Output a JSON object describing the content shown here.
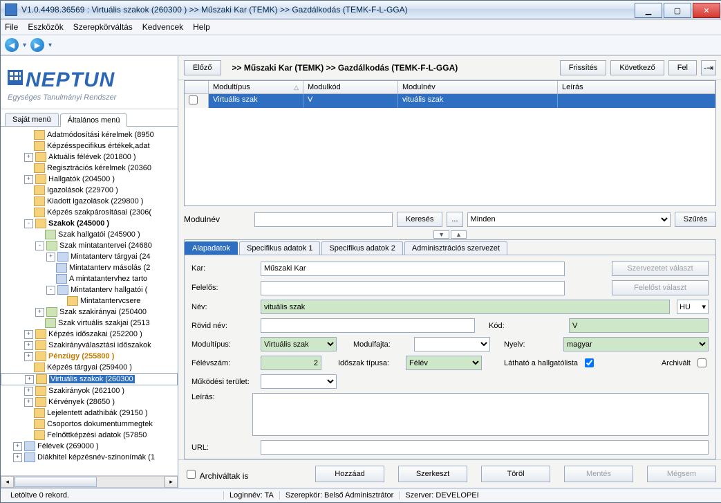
{
  "window": {
    "title": "V1.0.4498.36569 : Virtuális szakok (260300  )  >> Műszaki Kar (TEMK) >> Gazdálkodás (TEMK-F-L-GGA)"
  },
  "menu": {
    "file": "File",
    "eszkozok": "Eszközök",
    "szerep": "Szerepkörváltás",
    "kedvencek": "Kedvencek",
    "help": "Help"
  },
  "logo": {
    "text": "NEPTUN",
    "slogan": "Egységes Tanulmányi Rendszer"
  },
  "left_tabs": {
    "sajat": "Saját menü",
    "altalanos": "Általános menü"
  },
  "tree": [
    {
      "indent": 2,
      "exp": "",
      "lbl": "Adatmódosítási kérelmek (8950"
    },
    {
      "indent": 2,
      "exp": "",
      "lbl": "Képzésspecifikus értékek,adat"
    },
    {
      "indent": 2,
      "exp": "+",
      "lbl": "Aktuális félévek (201800  )"
    },
    {
      "indent": 2,
      "exp": "",
      "lbl": "Regisztrációs kérelmek (20360"
    },
    {
      "indent": 2,
      "exp": "+",
      "lbl": "Hallgatók (204500  )"
    },
    {
      "indent": 2,
      "exp": "",
      "lbl": "Igazolások (229700  )"
    },
    {
      "indent": 2,
      "exp": "",
      "lbl": "Kiadott igazolások (229800  )"
    },
    {
      "indent": 2,
      "exp": "",
      "lbl": "Képzés szakpárosításai (2306("
    },
    {
      "indent": 2,
      "exp": "-",
      "bold": true,
      "lbl": "Szakok (245000  )"
    },
    {
      "indent": 3,
      "exp": "",
      "icon": "alt",
      "lbl": "Szak hallgatói (245900  )"
    },
    {
      "indent": 3,
      "exp": "-",
      "icon": "alt",
      "lbl": "Szak mintatantervei (24680"
    },
    {
      "indent": 4,
      "exp": "+",
      "icon": "alt2",
      "lbl": "Mintatanterv tárgyai (24"
    },
    {
      "indent": 4,
      "exp": "",
      "icon": "alt2",
      "lbl": "Mintatanterv másolás (2"
    },
    {
      "indent": 4,
      "exp": "",
      "icon": "alt2",
      "lbl": "A mintatantervhez tarto"
    },
    {
      "indent": 4,
      "exp": "-",
      "icon": "alt2",
      "lbl": "Mintatanterv hallgatói ("
    },
    {
      "indent": 5,
      "exp": "",
      "lbl": "Mintatantervcsere"
    },
    {
      "indent": 3,
      "exp": "+",
      "icon": "alt",
      "lbl": "Szak szakirányai (250400"
    },
    {
      "indent": 3,
      "exp": "",
      "icon": "alt",
      "lbl": "Szak virtuális szakjai (2513"
    },
    {
      "indent": 2,
      "exp": "+",
      "lbl": "Képzés időszakai (252200  )"
    },
    {
      "indent": 2,
      "exp": "+",
      "lbl": "Szakirányválasztási időszakok"
    },
    {
      "indent": 2,
      "exp": "+",
      "hl": true,
      "lbl": "Pénzügy (255800  )"
    },
    {
      "indent": 2,
      "exp": "",
      "lbl": "Képzés tárgyai (259400  )"
    },
    {
      "indent": 2,
      "exp": "+",
      "sel": true,
      "lbl": "Virtuális szakok (260300"
    },
    {
      "indent": 2,
      "exp": "+",
      "lbl": "Szakirányok (262100  )"
    },
    {
      "indent": 2,
      "exp": "+",
      "lbl": "Kérvények (28650  )"
    },
    {
      "indent": 2,
      "exp": "",
      "lbl": "Lejelentett adathibák (29150  )"
    },
    {
      "indent": 2,
      "exp": "",
      "lbl": "Csoportos dokumentummegtek"
    },
    {
      "indent": 2,
      "exp": "",
      "lbl": "Felnőttképzési adatok (57850"
    },
    {
      "indent": 1,
      "exp": "+",
      "icon": "alt2",
      "lbl": "Félévek (269000  )"
    },
    {
      "indent": 1,
      "exp": "+",
      "icon": "alt2",
      "lbl": "Diákhitel képzésnév-szinonímák (1"
    }
  ],
  "header": {
    "prev": "Előző",
    "path": ">> Műszaki Kar (TEMK) >> Gazdálkodás (TEMK-F-L-GGA)",
    "refresh": "Frissítés",
    "next": "Következő",
    "up": "Fel",
    "pin": "-⇥"
  },
  "grid": {
    "cols": {
      "c1": "Modultípus",
      "c2": "Modulkód",
      "c3": "Modulnév",
      "c4": "Leírás"
    },
    "row": {
      "c1": "Virtuális szak",
      "c2": "V",
      "c3": "vituális szak",
      "c4": ""
    }
  },
  "search": {
    "label": "Modulnév",
    "keres": "Keresés",
    "dots": "...",
    "minden": "Minden",
    "szures": "Szűrés"
  },
  "tabs": {
    "t1": "Alapadatok",
    "t2": "Specifikus adatok 1",
    "t3": "Specifikus adatok 2",
    "t4": "Adminisztrációs szervezet"
  },
  "form": {
    "kar_l": "Kar:",
    "kar_v": "Műszaki Kar",
    "szervbtn": "Szervezetet választ",
    "felelos_l": "Felelős:",
    "felelos_v": "",
    "felelosbtn": "Felelőst választ",
    "nev_l": "Név:",
    "nev_v": "vituális szak",
    "lang": "HU",
    "rovid_l": "Rövid név:",
    "rovid_v": "",
    "kod_l": "Kód:",
    "kod_v": "V",
    "mtip_l": "Modultípus:",
    "mtip_v": "Virtuális szak",
    "mfajta_l": "Modulfajta:",
    "mfajta_v": "",
    "nyelv_l": "Nyelv:",
    "nyelv_v": "magyar",
    "felev_l": "Félévszám:",
    "felev_v": "2",
    "idotip_l": "Időszak típusa:",
    "idotip_v": "Félév",
    "lathato_l": "Látható a hallgatólista",
    "archivalt_l": "Archivált",
    "muk_l": "Működési terület:",
    "leiras_l": "Leírás:",
    "url_l": "URL:"
  },
  "footer": {
    "archivaltak": "Archiváltak is",
    "hozzaad": "Hozzáad",
    "szerkeszt": "Szerkeszt",
    "torol": "Töröl",
    "mentes": "Mentés",
    "megsem": "Mégsem"
  },
  "status": {
    "left": "Letöltve 0 rekord.",
    "login": "Loginnév: TA",
    "szerep": "Szerepkör: Belső Adminisztrátor",
    "szerver": "Szerver: DEVELOPEI"
  }
}
